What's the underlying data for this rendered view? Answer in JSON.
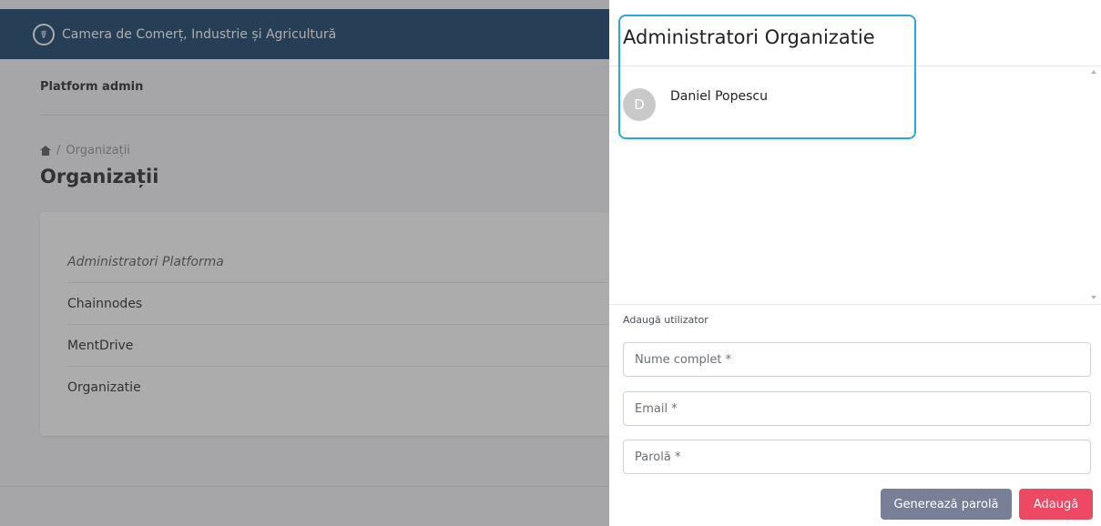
{
  "background": {
    "brand": "Camera de Comerț, Industrie și Agricultură",
    "brand_icon": "caduceus-logo-icon",
    "subheader": "Platform admin",
    "breadcrumb": {
      "home_icon": "home-icon",
      "separator": "/",
      "current": "Organizații"
    },
    "page_title": "Organizații",
    "organizations": [
      "Administratori Platforma",
      "Chainnodes",
      "MentDrive",
      "Organizatie"
    ]
  },
  "drawer": {
    "title": "Administratori Organizatie",
    "members": [
      {
        "initial": "D",
        "name": "Daniel Popescu"
      }
    ],
    "add_section_label": "Adaugă utilizator",
    "fields": {
      "full_name": {
        "placeholder": "Nume complet *",
        "value": ""
      },
      "email": {
        "placeholder": "Email *",
        "value": ""
      },
      "password": {
        "placeholder": "Parolă *",
        "value": ""
      }
    },
    "buttons": {
      "generate_password": "Generează parolă",
      "add": "Adaugă"
    }
  },
  "colors": {
    "topbar": "#0b3a63",
    "highlight": "#29a9e1",
    "add_button": "#ee4964",
    "generate_button": "#787f96"
  }
}
